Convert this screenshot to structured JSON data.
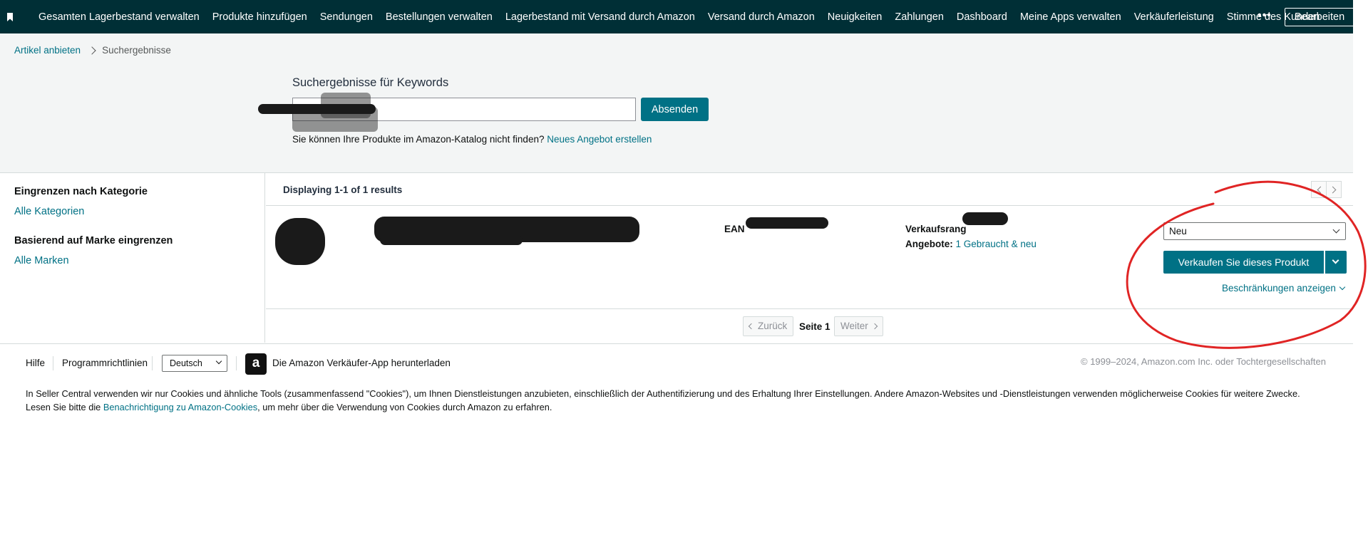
{
  "nav": {
    "items": [
      "Gesamten Lagerbestand verwalten",
      "Produkte hinzufügen",
      "Sendungen",
      "Bestellungen verwalten",
      "Lagerbestand mit Versand durch Amazon",
      "Versand durch Amazon",
      "Neuigkeiten",
      "Zahlungen",
      "Dashboard",
      "Meine Apps verwalten",
      "Verkäuferleistung",
      "Stimme des Kunden"
    ],
    "more_label": "•••",
    "edit_label": "Bearbeiten"
  },
  "breadcrumb": {
    "parent": "Artikel anbieten",
    "current": "Suchergebnisse"
  },
  "search": {
    "title": "Suchergebnisse für Keywords",
    "value": "",
    "submit_label": "Absenden",
    "cant_find_text": "Sie können Ihre Produkte im Amazon-Katalog nicht finden?",
    "create_link": "Neues Angebot erstellen"
  },
  "filters": {
    "category_heading": "Eingrenzen nach Kategorie",
    "category_link": "Alle Kategorien",
    "brand_heading": "Basierend auf Marke eingrenzen",
    "brand_link": "Alle Marken"
  },
  "results": {
    "count_text": "Displaying 1-1 of 1 results",
    "row": {
      "ean_label": "EAN",
      "rank_label": "Verkaufsrang",
      "offers_label": "Angebote:",
      "offers_link": "1 Gebraucht & neu",
      "condition_value": "Neu",
      "sell_label": "Verkaufen Sie dieses Produkt",
      "restrictions_label": "Beschränkungen anzeigen"
    },
    "pager": {
      "prev": "Zurück",
      "page": "Seite 1",
      "next": "Weiter"
    }
  },
  "footer": {
    "help": "Hilfe",
    "policies": "Programmrichtlinien",
    "language": "Deutsch",
    "app_icon": "a",
    "app_text": "Die Amazon Verkäufer-App herunterladen",
    "copyright": "© 1999–2024, Amazon.com Inc. oder Tochtergesellschaften",
    "cookie_line1": "In Seller Central verwenden wir nur Cookies und ähnliche Tools (zusammenfassend \"Cookies\"), um Ihnen Dienstleistungen anzubieten, einschließlich der Authentifizierung und des Erhaltung Ihrer Einstellungen. Andere Amazon-Websites und -Dienstleistungen verwenden möglicherweise Cookies für weitere Zwecke.",
    "cookie_line2_pre": "Lesen Sie bitte die",
    "cookie_link": "Benachrichtigung zu Amazon-Cookies",
    "cookie_line2_post": ", um mehr über die Verwendung von Cookies durch Amazon zu erfahren."
  },
  "colors": {
    "nav_bg": "#002f36",
    "link": "#007185",
    "button": "#007185",
    "annotation": "#e02424"
  }
}
